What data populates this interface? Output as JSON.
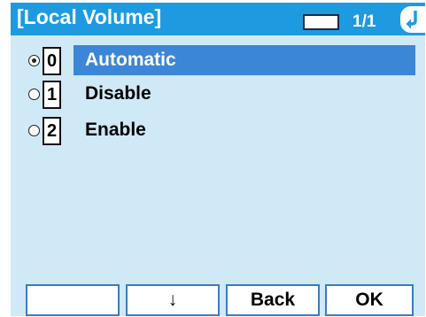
{
  "header": {
    "title": "[Local Volume]",
    "page_indicator": "1/1",
    "back_icon": "return-arrow-icon"
  },
  "menu": {
    "items": [
      {
        "number": "0",
        "label": "Automatic",
        "selected": true
      },
      {
        "number": "1",
        "label": "Disable",
        "selected": false
      },
      {
        "number": "2",
        "label": "Enable",
        "selected": false
      }
    ]
  },
  "softkeys": {
    "key1": "",
    "key2": "↓",
    "key3": "Back",
    "key4": "OK"
  },
  "colors": {
    "titlebar": "#1e9be0",
    "screen_bg": "#cfe9f7",
    "highlight": "#3b86d6",
    "softkey_border": "#3b7cc0"
  }
}
